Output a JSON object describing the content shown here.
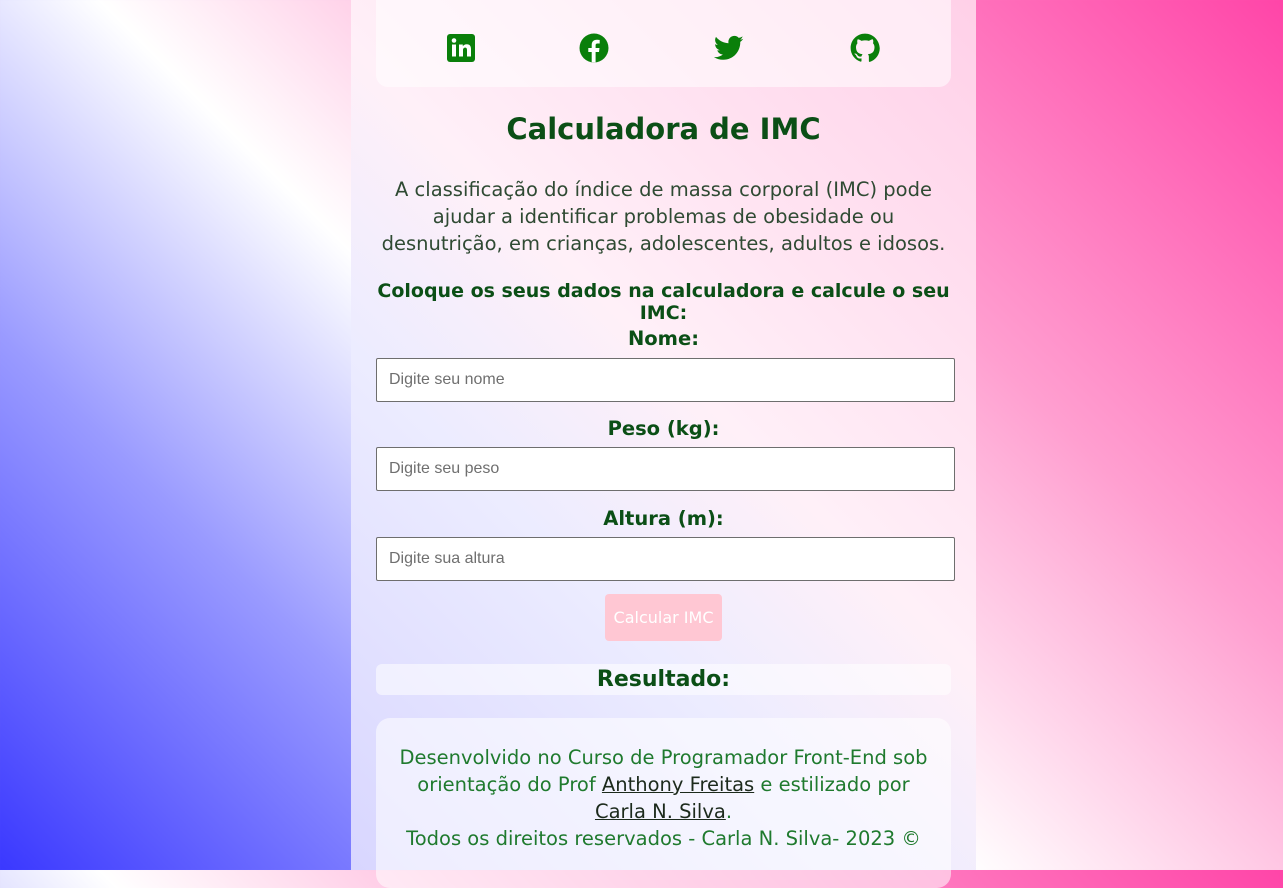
{
  "social": [
    {
      "name": "LinkedIn",
      "icon": "linkedin-icon"
    },
    {
      "name": "Facebook",
      "icon": "facebook-icon"
    },
    {
      "name": "Twitter",
      "icon": "twitter-icon"
    },
    {
      "name": "GitHub",
      "icon": "github-icon"
    }
  ],
  "colors": {
    "accent_green": "#0b4f16",
    "icon_green": "#0a7f0a",
    "button_pink": "#ffc7d3"
  },
  "header": {
    "title": "Calculadora de IMC",
    "intro": "A classificação do índice de massa corporal (IMC) pode ajudar a identificar problemas de obesidade ou desnutrição, em crianças, adolescentes, adultos e idosos.",
    "subtitle": "Coloque os seus dados na calculadora e calcule o seu IMC:"
  },
  "form": {
    "name_label": "Nome:",
    "name_placeholder": "Digite seu nome",
    "name_value": "",
    "weight_label": "Peso (kg):",
    "weight_placeholder": "Digite seu peso",
    "weight_value": "",
    "height_label": "Altura (m):",
    "height_placeholder": "Digite sua altura",
    "height_value": "",
    "submit_label": "Calcular IMC"
  },
  "result": {
    "label": "Resultado:"
  },
  "footer": {
    "line1_prefix": "Desenvolvido no Curso de Programador Front-End sob orientação do Prof",
    "teacher_link": "Anthony Freitas",
    "line1_middle": "e estilizado por",
    "author_link": "Carla N. Silva",
    "line1_suffix": ".",
    "copyright": "Todos os direitos reservados - Carla N. Silva- 2023 ©"
  }
}
